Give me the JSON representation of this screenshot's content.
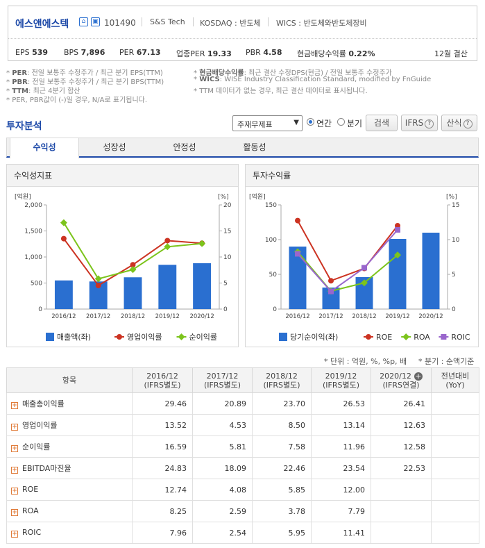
{
  "header": {
    "company_name": "에스앤에스텍",
    "code": "101490",
    "eng_name": "S&S Tech",
    "market": "KOSDAQ : 반도체",
    "wics": "WICS : 반도체와반도체장비",
    "settlement": "12월 결산",
    "icons": [
      "home-icon",
      "building-icon"
    ],
    "metrics": [
      {
        "label": "EPS",
        "value": "539"
      },
      {
        "label": "BPS",
        "value": "7,896"
      },
      {
        "label": "PER",
        "value": "67.13"
      },
      {
        "label": "업종PER",
        "value": "19.33"
      },
      {
        "label": "PBR",
        "value": "4.58"
      },
      {
        "label": "현금배당수익률",
        "value": "0.22%"
      }
    ]
  },
  "footnotes": {
    "left": [
      {
        "term": "PER",
        "desc": ": 전일 보통주 수정주가 / 최근 분기 EPS(TTM)"
      },
      {
        "term": "PBR",
        "desc": ": 전일 보통주 수정주가 / 최근 분기 BPS(TTM)"
      },
      {
        "term": "TTM",
        "desc": ": 최근 4분기 합산"
      },
      {
        "term": "",
        "desc": "PER, PBR값이 (-)일 경우, N/A로 표기됩니다."
      }
    ],
    "right": [
      {
        "term": "현금배당수익률",
        "desc": ": 최근 결산 수정DPS(현금) / 전일 보통주 수정주가"
      },
      {
        "term": "WICS",
        "desc": ": WISE Industry Classification Standard, modified by FnGuide"
      },
      {
        "term": "",
        "desc": "TTM 데이터가 없는 경우, 최근 결산 데이터로 표시됩니다."
      }
    ]
  },
  "section": {
    "title": "투자분석",
    "select_value": "주재무제표",
    "radio_annual": "연간",
    "radio_quarter": "분기",
    "search_button": "검색",
    "ifrs_button": "IFRS",
    "formula_button": "산식"
  },
  "tabs": [
    "수익성",
    "성장성",
    "안정성",
    "활동성"
  ],
  "active_tab": 0,
  "chart_data": [
    {
      "type": "bar+line",
      "title": "수익성지표",
      "categories": [
        "2016/12",
        "2017/12",
        "2018/12",
        "2019/12",
        "2020/12"
      ],
      "left_axis": {
        "unit": "[억원]",
        "ylim": [
          0,
          2000
        ],
        "ticks": [
          0,
          500,
          1000,
          1500,
          2000
        ],
        "tick_labels": [
          "0",
          "500",
          "1,000",
          "1,500",
          "2,000"
        ]
      },
      "right_axis": {
        "unit": "[%]",
        "ylim": [
          0,
          20
        ],
        "ticks": [
          0,
          5,
          10,
          15,
          20
        ],
        "tick_labels": [
          "0",
          "5",
          "10",
          "15",
          "20"
        ]
      },
      "series": [
        {
          "name": "매출액(좌)",
          "kind": "bar",
          "axis": "left",
          "color": "#2a6fd0",
          "values": [
            550,
            530,
            610,
            850,
            880
          ]
        },
        {
          "name": "영업이익률",
          "kind": "line",
          "axis": "right",
          "color": "#cc3322",
          "marker": "circle",
          "values": [
            13.52,
            4.53,
            8.5,
            13.14,
            12.63
          ]
        },
        {
          "name": "순이익률",
          "kind": "line",
          "axis": "right",
          "color": "#7cc41c",
          "marker": "diamond",
          "values": [
            16.59,
            5.81,
            7.58,
            11.96,
            12.58
          ]
        }
      ],
      "legend": "bottom"
    },
    {
      "type": "bar+line",
      "title": "투자수익률",
      "categories": [
        "2016/12",
        "2017/12",
        "2018/12",
        "2019/12",
        "2020/12"
      ],
      "left_axis": {
        "unit": "[억원]",
        "ylim": [
          0,
          150
        ],
        "ticks": [
          0,
          50,
          100,
          150
        ],
        "tick_labels": [
          "0",
          "50",
          "100",
          "150"
        ]
      },
      "right_axis": {
        "unit": "[%]",
        "ylim": [
          0,
          15
        ],
        "ticks": [
          0,
          5,
          10,
          15
        ],
        "tick_labels": [
          "0",
          "5",
          "10",
          "15"
        ]
      },
      "series": [
        {
          "name": "당기순이익(좌)",
          "kind": "bar",
          "axis": "left",
          "color": "#2a6fd0",
          "values": [
            90,
            31,
            46,
            101,
            110
          ]
        },
        {
          "name": "ROE",
          "kind": "line",
          "axis": "right",
          "color": "#cc3322",
          "marker": "circle",
          "values": [
            12.74,
            4.08,
            5.85,
            12.0,
            null
          ]
        },
        {
          "name": "ROA",
          "kind": "line",
          "axis": "right",
          "color": "#7cc41c",
          "marker": "diamond",
          "values": [
            8.25,
            2.59,
            3.78,
            7.79,
            null
          ]
        },
        {
          "name": "ROIC",
          "kind": "line",
          "axis": "right",
          "color": "#9966cc",
          "marker": "square",
          "values": [
            7.96,
            2.54,
            5.95,
            11.41,
            null
          ]
        }
      ],
      "legend": "bottom"
    },
    {
      "type": "table",
      "unit_note": "* 단위 : 억원, %, %p, 배",
      "quarter_note": "* 분기 : 순액기준",
      "header_label": "항목",
      "columns": [
        {
          "period": "2016/12",
          "basis": "(IFRS별도)"
        },
        {
          "period": "2017/12",
          "basis": "(IFRS별도)"
        },
        {
          "period": "2018/12",
          "basis": "(IFRS별도)"
        },
        {
          "period": "2019/12",
          "basis": "(IFRS별도)"
        },
        {
          "period": "2020/12",
          "basis": "(IFRS연결)"
        },
        {
          "period": "전년대비",
          "basis": "(YoY)"
        }
      ],
      "rows": [
        {
          "label": "매출총이익률",
          "values": [
            "29.46",
            "20.89",
            "23.70",
            "26.53",
            "26.41",
            ""
          ]
        },
        {
          "label": "영업이익률",
          "values": [
            "13.52",
            "4.53",
            "8.50",
            "13.14",
            "12.63",
            ""
          ]
        },
        {
          "label": "순이익률",
          "values": [
            "16.59",
            "5.81",
            "7.58",
            "11.96",
            "12.58",
            ""
          ]
        },
        {
          "label": "EBITDA마진율",
          "values": [
            "24.83",
            "18.09",
            "22.46",
            "23.54",
            "22.53",
            ""
          ]
        },
        {
          "label": "ROE",
          "values": [
            "12.74",
            "4.08",
            "5.85",
            "12.00",
            "",
            ""
          ]
        },
        {
          "label": "ROA",
          "values": [
            "8.25",
            "2.59",
            "3.78",
            "7.79",
            "",
            ""
          ]
        },
        {
          "label": "ROIC",
          "values": [
            "7.96",
            "2.54",
            "5.95",
            "11.41",
            "",
            ""
          ]
        }
      ]
    }
  ]
}
